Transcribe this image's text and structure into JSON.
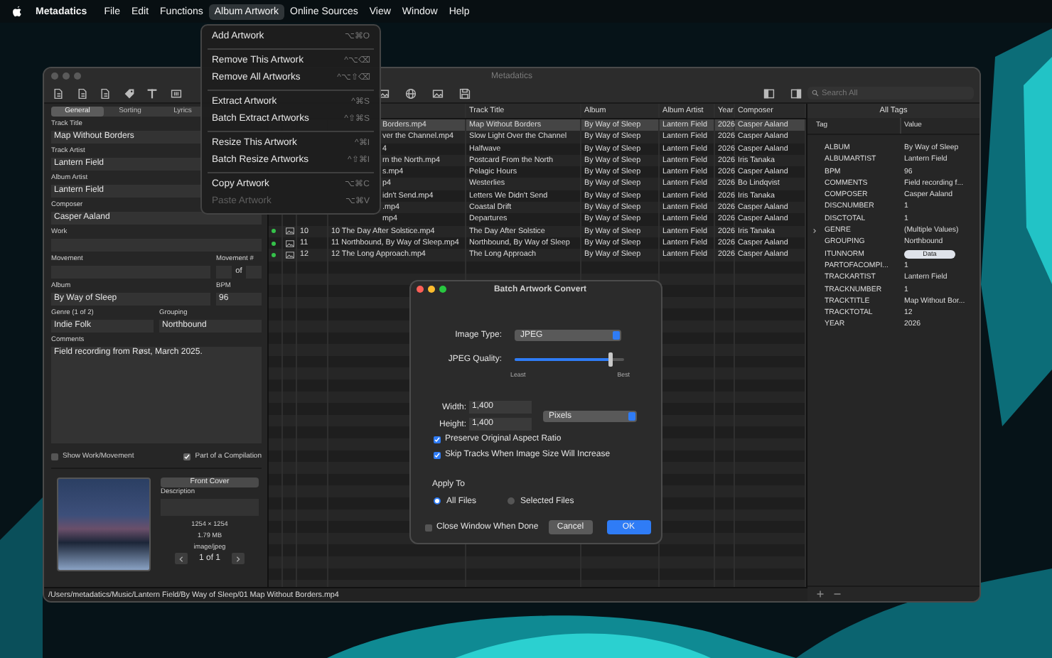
{
  "menubar": {
    "app_name": "Metadatics",
    "menus": [
      {
        "label": "File",
        "selected": false
      },
      {
        "label": "Edit",
        "selected": false
      },
      {
        "label": "Functions",
        "selected": false
      },
      {
        "label": "Album Artwork",
        "selected": true
      },
      {
        "label": "Online Sources",
        "selected": false
      },
      {
        "label": "View",
        "selected": false
      },
      {
        "label": "Window",
        "selected": false
      },
      {
        "label": "Help",
        "selected": false
      }
    ]
  },
  "menu": {
    "groups": [
      {
        "items": [
          {
            "label": "Add Artwork",
            "shortcut": "⌥⌘O",
            "disabled": false
          }
        ]
      },
      {
        "items": [
          {
            "label": "Remove This Artwork",
            "shortcut": "^⌥⌫",
            "disabled": false
          },
          {
            "label": "Remove All Artworks",
            "shortcut": "^⌥⇧⌫",
            "disabled": false
          }
        ]
      },
      {
        "items": [
          {
            "label": "Extract Artwork",
            "shortcut": "^⌘S",
            "disabled": false
          },
          {
            "label": "Batch Extract Artworks",
            "shortcut": "^⇧⌘S",
            "disabled": false
          }
        ]
      },
      {
        "items": [
          {
            "label": "Resize This Artwork",
            "shortcut": "^⌘I",
            "disabled": false
          },
          {
            "label": "Batch Resize Artworks",
            "shortcut": "^⇧⌘I",
            "disabled": false
          }
        ]
      },
      {
        "items": [
          {
            "label": "Copy Artwork",
            "shortcut": "⌥⌘C",
            "disabled": false
          },
          {
            "label": "Paste Artwork",
            "shortcut": "⌥⌘V",
            "disabled": true
          }
        ]
      }
    ]
  },
  "window": {
    "title": "Metadatics",
    "search": {
      "placeholder": "Search All"
    },
    "editor": {
      "tabs": [
        {
          "label": "General",
          "selected": true
        },
        {
          "label": "Sorting",
          "selected": false
        },
        {
          "label": "Lyrics",
          "selected": false
        }
      ],
      "rows": [
        {
          "fields": [
            {
              "label": "Track Title",
              "value": "Map Without Borders",
              "kind": "text"
            }
          ]
        },
        {
          "fields": [
            {
              "label": "Track Artist",
              "value": "Lantern Field",
              "kind": "text"
            }
          ]
        },
        {
          "fields": [
            {
              "label": "Album Artist",
              "value": "Lantern Field",
              "kind": "text"
            }
          ]
        },
        {
          "fields": [
            {
              "label": "Composer",
              "value": "Casper Aaland",
              "kind": "text"
            }
          ]
        },
        {
          "fields": [
            {
              "label": "Work",
              "kind": "text"
            }
          ]
        },
        {
          "fields": [
            {
              "label": "Movement",
              "kind": "text"
            },
            {
              "label": "Movement #",
              "joiner": "of",
              "kind": "pair"
            }
          ]
        },
        {
          "fields": [
            {
              "label": "Album",
              "value": "By Way of Sleep",
              "kind": "text"
            },
            {
              "label": "BPM",
              "value": "96",
              "kind": "short"
            }
          ]
        },
        {
          "fields": [
            {
              "label": "Genre (1 of 2)",
              "value": "Indie Folk",
              "kind": "text"
            },
            {
              "label": "Grouping",
              "value": "Northbound",
              "kind": "text"
            }
          ]
        },
        {
          "fields": [
            {
              "label": "Comments",
              "value": "Field recording from Røst, March 2025.",
              "kind": "area"
            }
          ]
        }
      ],
      "options": [
        {
          "label": "Show Work/Movement",
          "checked": false
        },
        {
          "label": "Part of a Compilation",
          "checked": true
        }
      ],
      "artwork": {
        "type": "Front Cover",
        "description_label": "Description",
        "dimensions": "1254 × 1254",
        "size": "1.79 MB",
        "mime": "image/jpeg",
        "pager": "1 of 1"
      }
    },
    "table": {
      "columns": [
        "Track Title",
        "Album",
        "Album Artist",
        "Year",
        "Composer"
      ],
      "rows": [
        {
          "file": "Borders.mp4",
          "cells": [
            "Map Without Borders",
            "By Way of Sleep",
            "Lantern Field",
            "2026",
            "Casper Aaland"
          ],
          "selected": true
        },
        {
          "file": "ver the Channel.mp4",
          "cells": [
            "Slow Light Over the Channel",
            "By Way of Sleep",
            "Lantern Field",
            "2026",
            "Casper Aaland"
          ],
          "selected": false
        },
        {
          "file": "4",
          "cells": [
            "Halfwave",
            "By Way of Sleep",
            "Lantern Field",
            "2026",
            "Casper Aaland"
          ],
          "selected": false
        },
        {
          "file": "rn the North.mp4",
          "cells": [
            "Postcard From the North",
            "By Way of Sleep",
            "Lantern Field",
            "2026",
            "Iris Tanaka"
          ],
          "selected": false
        },
        {
          "file": "s.mp4",
          "cells": [
            "Pelagic Hours",
            "By Way of Sleep",
            "Lantern Field",
            "2026",
            "Casper Aaland"
          ],
          "selected": false
        },
        {
          "file": "p4",
          "cells": [
            "Westerlies",
            "By Way of Sleep",
            "Lantern Field",
            "2026",
            "Bo Lindqvist"
          ],
          "selected": false
        },
        {
          "file": "idn't Send.mp4",
          "cells": [
            "Letters We Didn't Send",
            "By Way of Sleep",
            "Lantern Field",
            "2026",
            "Iris Tanaka"
          ],
          "selected": false
        },
        {
          "file": ".mp4",
          "cells": [
            "Coastal Drift",
            "By Way of Sleep",
            "Lantern Field",
            "2026",
            "Casper Aaland"
          ],
          "selected": false
        },
        {
          "file": "mp4",
          "cells": [
            "Departures",
            "By Way of Sleep",
            "Lantern Field",
            "2026",
            "Casper Aaland"
          ],
          "selected": false
        },
        {
          "number": "10",
          "file": "10 The Day After Solstice.mp4",
          "cells": [
            "The Day After Solstice",
            "By Way of Sleep",
            "Lantern Field",
            "2026",
            "Iris Tanaka"
          ],
          "selected": false
        },
        {
          "number": "11",
          "file": "11 Northbound, By Way of Sleep.mp4",
          "cells": [
            "Northbound, By Way of Sleep",
            "By Way of Sleep",
            "Lantern Field",
            "2026",
            "Casper Aaland"
          ],
          "selected": false
        },
        {
          "number": "12",
          "file": "12 The Long Approach.mp4",
          "cells": [
            "The Long Approach",
            "By Way of Sleep",
            "Lantern Field",
            "2026",
            "Casper Aaland"
          ],
          "selected": false
        }
      ]
    },
    "tags": {
      "title": "All Tags",
      "columns": [
        "Tag",
        "Value"
      ],
      "rows": [
        {
          "tag": "ALBUM",
          "value": "By Way of Sleep",
          "kind": "text"
        },
        {
          "tag": "ALBUMARTIST",
          "value": "Lantern Field",
          "kind": "text"
        },
        {
          "tag": "BPM",
          "value": "96",
          "kind": "text"
        },
        {
          "tag": "COMMENTS",
          "value": "Field recording f...",
          "kind": "text"
        },
        {
          "tag": "COMPOSER",
          "value": "Casper Aaland",
          "kind": "text"
        },
        {
          "tag": "DISCNUMBER",
          "value": "1",
          "kind": "text"
        },
        {
          "tag": "DISCTOTAL",
          "value": "1",
          "kind": "text"
        },
        {
          "tag": "GENRE",
          "value": "(Multiple Values)",
          "kind": "group"
        },
        {
          "tag": "GROUPING",
          "value": "Northbound",
          "kind": "text"
        },
        {
          "tag": "ITUNNORM",
          "value": "Data",
          "kind": "data"
        },
        {
          "tag": "PARTOFACOMPI...",
          "value": "1",
          "kind": "text"
        },
        {
          "tag": "TRACKARTIST",
          "value": "Lantern Field",
          "kind": "text"
        },
        {
          "tag": "TRACKNUMBER",
          "value": "1",
          "kind": "text"
        },
        {
          "tag": "TRACKTITLE",
          "value": "Map Without Bor...",
          "kind": "text"
        },
        {
          "tag": "TRACKTOTAL",
          "value": "12",
          "kind": "text"
        },
        {
          "tag": "YEAR",
          "value": "2026",
          "kind": "text"
        }
      ]
    },
    "status_path": "/Users/metadatics/Music/Lantern Field/By Way of Sleep/01 Map Without Borders.mp4"
  },
  "dialog": {
    "title": "Batch Artwork Convert",
    "image_type": {
      "label": "Image Type:",
      "value": "JPEG"
    },
    "quality": {
      "label": "JPEG Quality:",
      "level": 0.88,
      "min_label": "Least",
      "max_label": "Best"
    },
    "width": {
      "label": "Width:",
      "value": "1,400"
    },
    "height": {
      "label": "Height:",
      "value": "1,400"
    },
    "unit": "Pixels",
    "options": [
      {
        "label": "Preserve Original Aspect Ratio",
        "checked": true
      },
      {
        "label": "Skip Tracks When Image Size Will Increase",
        "checked": true
      }
    ],
    "apply_to": {
      "label": "Apply To",
      "choices": [
        {
          "label": "All Files",
          "selected": true
        },
        {
          "label": "Selected Files",
          "selected": false
        }
      ]
    },
    "close_when_done": {
      "label": "Close Window When Done",
      "checked": false
    },
    "buttons": [
      {
        "label": "Cancel",
        "kind": "secondary"
      },
      {
        "label": "OK",
        "kind": "primary"
      }
    ]
  }
}
